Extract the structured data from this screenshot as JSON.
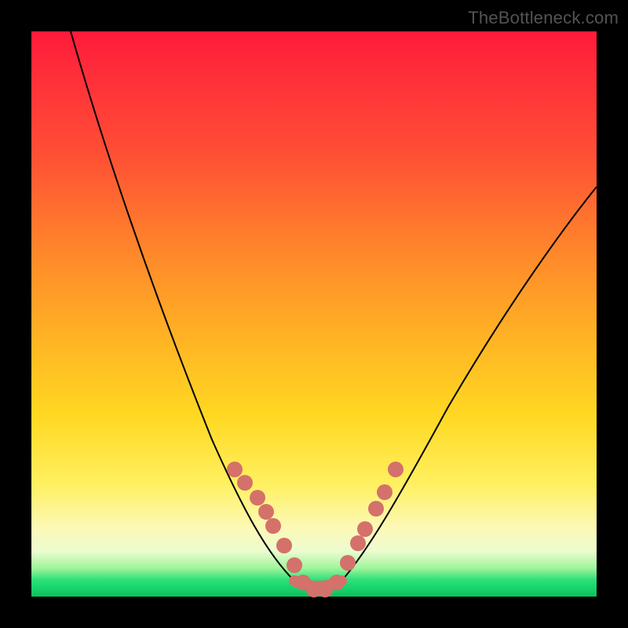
{
  "watermark": "TheBottleneck.com",
  "colors": {
    "frame": "#000000",
    "curve": "#000000",
    "beads": "#d4716a",
    "gradient_stops": [
      "#ff1a3a",
      "#ff5035",
      "#ff8a2a",
      "#ffb524",
      "#ffd822",
      "#fff060",
      "#fcf9b8",
      "#9ef59a",
      "#16d46b"
    ]
  },
  "chart_data": {
    "type": "line",
    "title": "",
    "xlabel": "",
    "ylabel": "",
    "xlim": [
      0,
      100
    ],
    "ylim": [
      0,
      100
    ],
    "note": "x and y are in percent of plot-area; y is plotted from bottom=0",
    "series": [
      {
        "name": "bottleneck-curve",
        "x": [
          7,
          12,
          17,
          22,
          27,
          31,
          35,
          38,
          41,
          44,
          47,
          50,
          53,
          56,
          59,
          63,
          68,
          74,
          81,
          89,
          97,
          100
        ],
        "y": [
          100,
          82,
          66,
          52,
          40,
          30,
          22,
          15,
          10,
          6,
          3,
          1,
          1,
          3,
          7,
          13,
          22,
          33,
          46,
          59,
          70,
          73
        ]
      }
    ],
    "beads": {
      "name": "highlight-points",
      "x_percent": [
        36.0,
        37.8,
        40.0,
        41.5,
        42.8,
        44.8,
        46.5,
        48.0,
        50.0,
        52.0,
        54.0,
        56.0,
        57.8,
        59.0,
        61.0,
        62.5,
        64.5
      ],
      "y_from_top_percent": [
        77.5,
        79.8,
        82.5,
        85.0,
        87.5,
        91.0,
        94.5,
        97.5,
        98.8,
        98.8,
        97.5,
        94.0,
        90.5,
        88.0,
        84.5,
        81.5,
        77.5
      ]
    }
  }
}
